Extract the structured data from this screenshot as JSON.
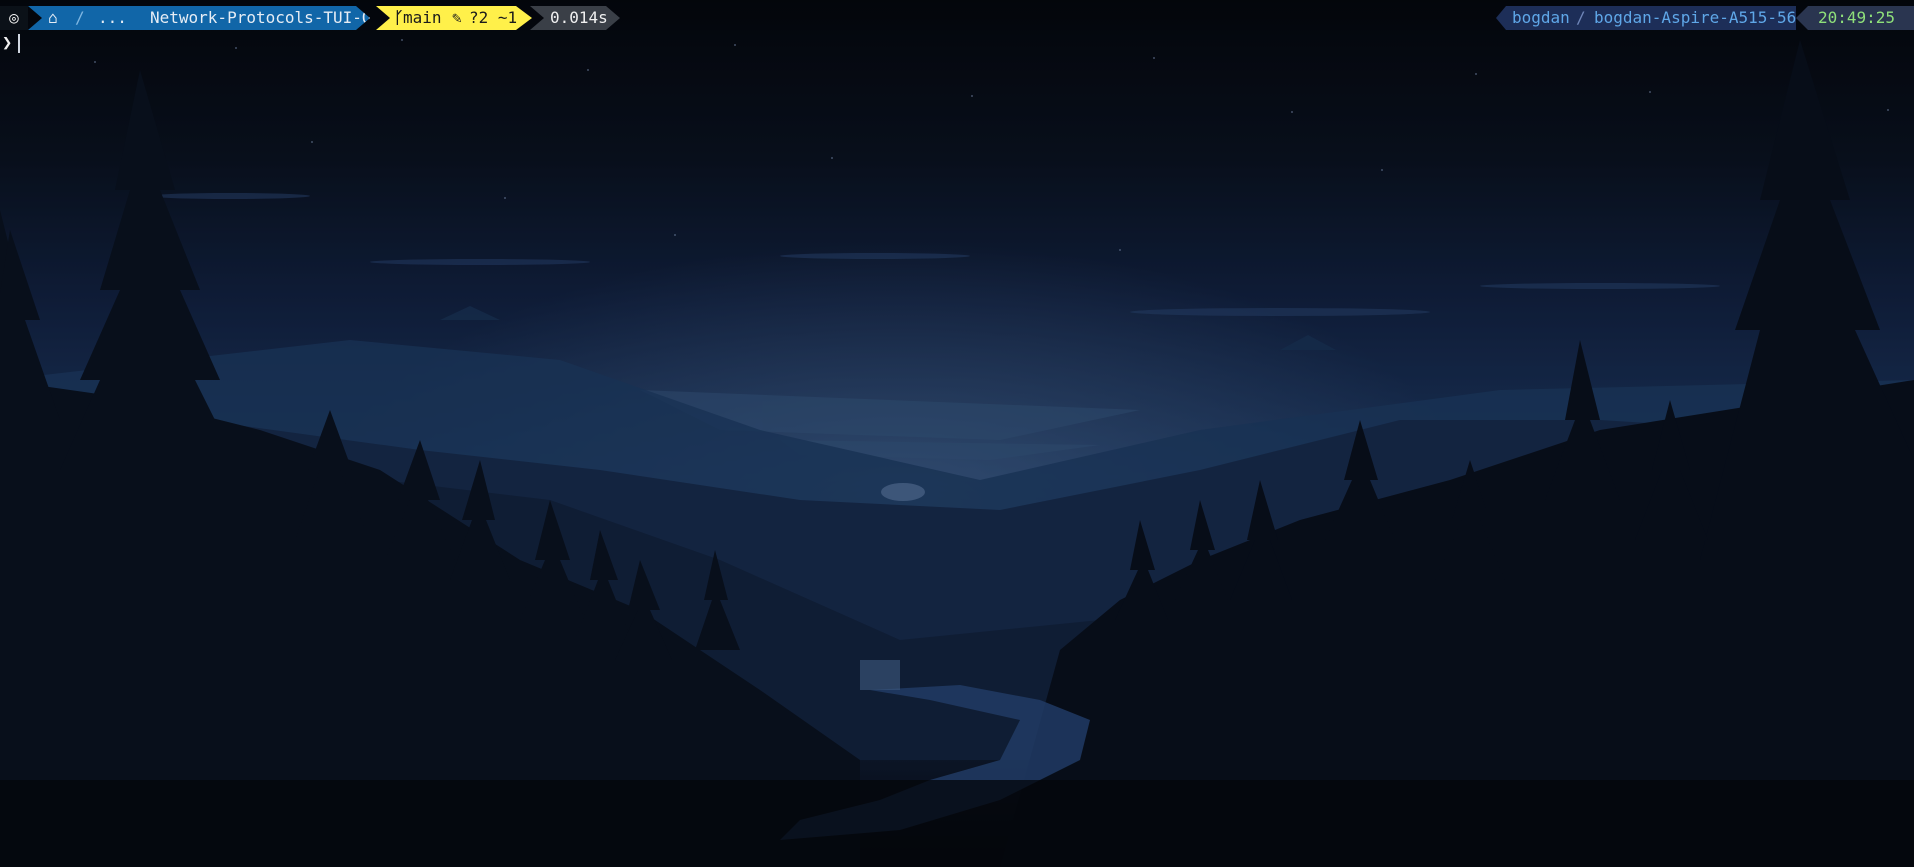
{
  "prompt": {
    "os_icon": "ubuntu-icon",
    "home_icon": "home-icon",
    "path_separator": "/",
    "path_ellipsis": "...",
    "directory": "Network-Protocols-TUI-Quiz",
    "git_icon": "git-branch-icon",
    "git_branch_glyph": "ᚴ",
    "branch": "main",
    "edit_icon": "edit-icon",
    "git_status": "?2 ~1",
    "exec_time": "0.014s",
    "user": "bogdan",
    "host_separator": "/",
    "host": "bogdan-Aspire-A515-56",
    "clock": "20:49:25",
    "input_chevron": "❯",
    "input_value": ""
  },
  "colors": {
    "path_bg": "#1166a8",
    "git_bg": "#fff04a",
    "time_bg": "#3a3f47",
    "user_bg": "#1d2e58",
    "clock_fg": "#8fe07a"
  }
}
